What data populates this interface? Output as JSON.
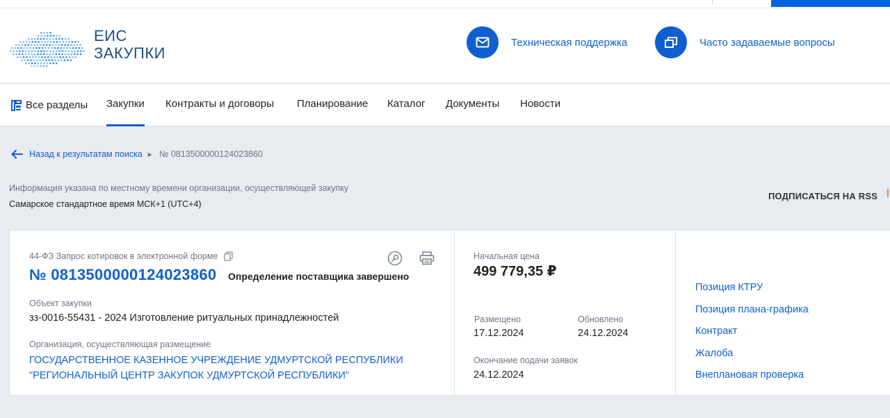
{
  "logo": {
    "line1": "ЕИС",
    "line2": "ЗАКУПКИ"
  },
  "header": {
    "support_label": "Техническая поддержка",
    "faq_label": "Часто задаваемые вопросы"
  },
  "nav": {
    "all": "Все разделы",
    "items": [
      "Закупки",
      "Контракты и договоры",
      "Планирование",
      "Каталог",
      "Документы",
      "Новости"
    ],
    "active": "Закупки"
  },
  "breadcrumb": {
    "back": "Назад к результатам поиска",
    "current": "№ 0813500000124023860"
  },
  "timezone": {
    "note": "Информация указана по местному времени организации, осуществляющей закупку",
    "zone": "Самарское стандартное время МСК+1 (UTC+4)"
  },
  "rss_label": "ПОДПИСАТЬСЯ НА RSS",
  "procurement": {
    "law": "44-ФЗ Запрос котировок в электронной форме",
    "number": "№ 0813500000124023860",
    "status": "Определение поставщика завершено",
    "object_label": "Объект закупки",
    "object_value": "зз-0016-55431 - 2024 Изготовление ритуальных принадлежностей",
    "org_label": "Организация, осуществляющая размещение",
    "org_line1": "ГОСУДАРСТВЕННОЕ КАЗЕННОЕ УЧРЕЖДЕНИЕ УДМУРТСКОЙ РЕСПУБЛИКИ",
    "org_line2": "\"РЕГИОНАЛЬНЫЙ ЦЕНТР ЗАКУПОК УДМУРТСКОЙ РЕСПУБЛИКИ\""
  },
  "price": {
    "label": "Начальная цена",
    "value": "499 779,35 ₽"
  },
  "dates": {
    "placed_label": "Размещено",
    "placed": "17.12.2024",
    "updated_label": "Обновлено",
    "updated": "24.12.2024",
    "deadline_label": "Окончание подачи заявок",
    "deadline": "24.12.2024"
  },
  "links": [
    "Позиция КТРУ",
    "Позиция плана-графика",
    "Контракт",
    "Жалоба",
    "Внеплановая проверка"
  ],
  "colors": {
    "accent": "#0f5fd1",
    "logo": "#1d4e89",
    "muted": "#6c7685",
    "rss_mark": "#f08a24"
  },
  "icons": {
    "support": "envelope-icon",
    "faq": "copy-windows-icon",
    "nav_all": "sections-icon",
    "back": "arrow-left-icon",
    "sep": "triangle-right-icon",
    "copy": "copy-icon",
    "search": "magnifier-icon",
    "print": "printer-icon"
  }
}
